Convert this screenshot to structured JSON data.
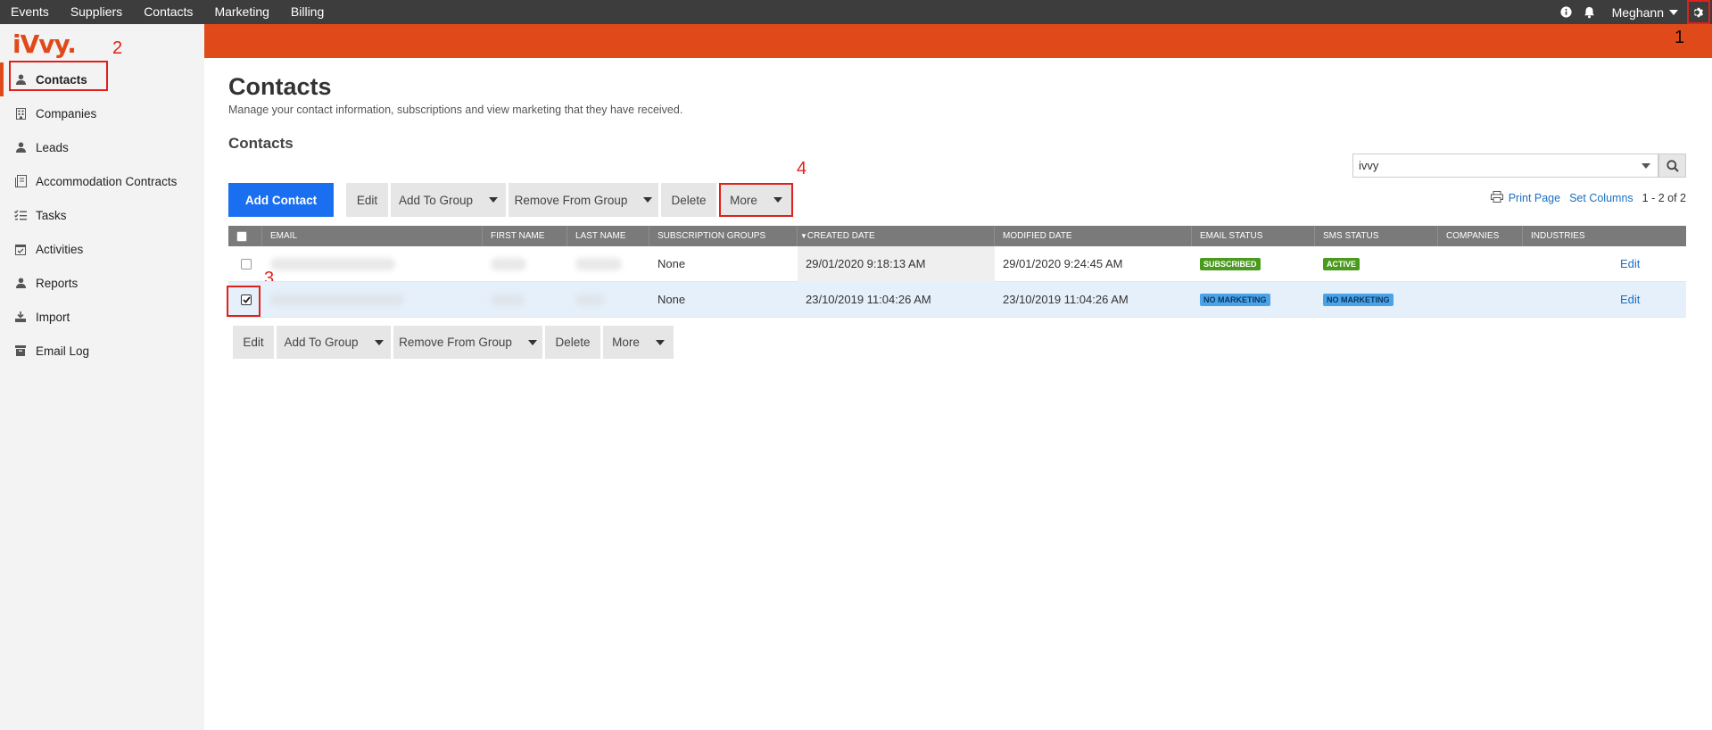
{
  "topnav": {
    "items": [
      "Events",
      "Suppliers",
      "Contacts",
      "Marketing",
      "Billing"
    ],
    "user": "Meghann"
  },
  "logo": {
    "text": "iVvy"
  },
  "sidebar": {
    "items": [
      {
        "label": "Contacts",
        "icon": "person-icon",
        "active": true
      },
      {
        "label": "Companies",
        "icon": "building-icon"
      },
      {
        "label": "Leads",
        "icon": "person-icon"
      },
      {
        "label": "Accommodation Contracts",
        "icon": "contract-icon"
      },
      {
        "label": "Tasks",
        "icon": "tasks-icon"
      },
      {
        "label": "Activities",
        "icon": "calendar-check-icon"
      },
      {
        "label": "Reports",
        "icon": "person-icon"
      },
      {
        "label": "Import",
        "icon": "download-icon"
      },
      {
        "label": "Email Log",
        "icon": "archive-icon"
      }
    ]
  },
  "annotations": [
    "1",
    "2",
    "3",
    "4"
  ],
  "page": {
    "title": "Contacts",
    "description": "Manage your contact information, subscriptions and view marketing that they have received.",
    "section_title": "Contacts"
  },
  "search": {
    "value": "ivvy"
  },
  "tools": {
    "print": "Print Page",
    "set_columns": "Set Columns",
    "count": "1 - 2 of 2"
  },
  "toolbar_top": {
    "add": "Add Contact",
    "edit": "Edit",
    "add_group": "Add To Group",
    "remove_group": "Remove From Group",
    "delete": "Delete",
    "more": "More"
  },
  "toolbar_bottom": {
    "edit": "Edit",
    "add_group": "Add To Group",
    "remove_group": "Remove From Group",
    "delete": "Delete",
    "more": "More"
  },
  "table": {
    "columns": [
      "Email",
      "First Name",
      "Last Name",
      "Subscription Groups",
      "Created Date",
      "Modified Date",
      "Email Status",
      "SMS Status",
      "Companies",
      "Industries"
    ],
    "sorted_column": "Created Date",
    "rows": [
      {
        "email": "",
        "first": "",
        "last": "",
        "groups": "None",
        "created": "29/01/2020 9:18:13 AM",
        "modified": "29/01/2020 9:24:45 AM",
        "email_status": "Subscribed",
        "sms_status": "Active",
        "edit": "Edit",
        "checked": false
      },
      {
        "email": "",
        "first": "",
        "last": "",
        "groups": "None",
        "created": "23/10/2019 11:04:26 AM",
        "modified": "23/10/2019 11:04:26 AM",
        "email_status": "No Marketing",
        "sms_status": "No Marketing",
        "edit": "Edit",
        "checked": true
      }
    ]
  },
  "colors": {
    "accent": "#e04a1b",
    "primary_button": "#1a6ff0",
    "annotation": "#e0201b"
  }
}
